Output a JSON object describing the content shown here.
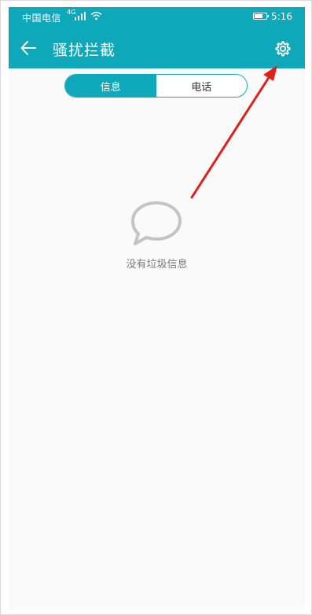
{
  "statusbar": {
    "carrier": "中国电信",
    "signal_type": "4G",
    "time": "5:16",
    "battery_level": 0.7
  },
  "appbar": {
    "title": "骚扰拦截",
    "back_icon": "back-arrow-icon",
    "settings_icon": "gear-icon"
  },
  "tabs": [
    {
      "label": "信息",
      "active": true
    },
    {
      "label": "电话",
      "active": false
    }
  ],
  "empty_state": {
    "icon": "chat-bubble-icon",
    "text": "没有垃圾信息"
  },
  "colors": {
    "primary": "#0fa8ba",
    "background": "#fafafa",
    "annotation_arrow": "#e0211b"
  }
}
